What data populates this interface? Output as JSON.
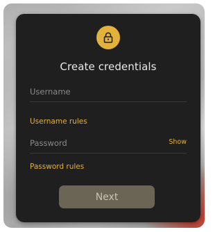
{
  "background": {
    "accent_red": "#c0392b"
  },
  "card": {
    "icon": "lock-icon",
    "title": "Create credentials"
  },
  "form": {
    "username": {
      "placeholder": "Username",
      "value": ""
    },
    "username_rules_link": "Username rules",
    "password": {
      "placeholder": "Password",
      "value": "",
      "show_label": "Show"
    },
    "password_rules_link": "Password rules",
    "next_button": {
      "label": "Next",
      "disabled": true
    }
  },
  "colors": {
    "card_bg": "#1f1f1f",
    "accent": "#e3b23c",
    "button_disabled_bg": "#6a6554",
    "text_primary": "#e9e9e9",
    "text_placeholder": "#8a8a8a"
  }
}
